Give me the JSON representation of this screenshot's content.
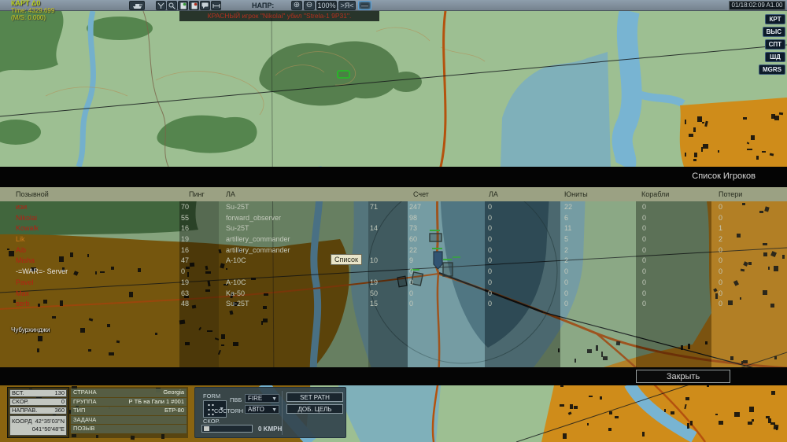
{
  "colors": {
    "accent_blue": "#5aa0d8",
    "red_player": "#b42014",
    "orange_player": "#cc7a1a",
    "urban_orange": "#cf8c1a",
    "water_teal": "#7fb0ba",
    "river_blue": "#74b0cc",
    "road_orange": "#b5520e"
  },
  "toolbar": {
    "map_label": "КАРТ Δ0",
    "time_label": "Time: 4329.699",
    "ms_label": "(M/S: 0.000)",
    "heading_label": "НАПР:",
    "zoom_in": "⊕",
    "zoom_out": "⊖",
    "zoom_value": "100%",
    "center_label": ">Я<",
    "pan_label": "—",
    "clock": "01/18:02:09 A1.00"
  },
  "kill_message": "КРАСНЫЙ игрок \"Nikolai\" убил \"Strela-1 9P31\".",
  "map_buttons": [
    "КРТ",
    "ВЫС",
    "СПТ",
    "ШД",
    "MGRS"
  ],
  "map_city_label": "Чубурхинджи",
  "player_list": {
    "title": "Список Игроков",
    "columns": [
      "Позывной",
      "Пинг",
      "ЛА",
      "Счет",
      "ЛА",
      "Юниты",
      "Корабли",
      "Потери"
    ],
    "tooltip": "Список",
    "close_label": "Закрыть",
    "rows": [
      {
        "name": "изи",
        "color": "#b42014",
        "ping": "70",
        "aircraft": "Su-25T",
        "kills": "71",
        "score": "247",
        "la": "0",
        "units": "22",
        "ships": "0",
        "losses": "0"
      },
      {
        "name": "Nikolai",
        "color": "#b42014",
        "ping": "55",
        "aircraft": "forward_observer",
        "kills": "",
        "score": "98",
        "la": "0",
        "units": "6",
        "ships": "0",
        "losses": "0"
      },
      {
        "name": "Kowalk",
        "color": "#b42014",
        "ping": "16",
        "aircraft": "Su-25T",
        "kills": "14",
        "score": "73",
        "la": "0",
        "units": "11",
        "ships": "0",
        "losses": "1"
      },
      {
        "name": "Lik",
        "color": "#cc7a1a",
        "ping": "19",
        "aircraft": "artillery_commander",
        "kills": "",
        "score": "60",
        "la": "0",
        "units": "5",
        "ships": "0",
        "losses": "2"
      },
      {
        "name": "Aib",
        "color": "#b42014",
        "ping": "16",
        "aircraft": "artillery_commander",
        "kills": "",
        "score": "22",
        "la": "0",
        "units": "2",
        "ships": "0",
        "losses": "0"
      },
      {
        "name": "Misha",
        "color": "#b42014",
        "ping": "47",
        "aircraft": "A-10C",
        "kills": "10",
        "score": "9",
        "la": "0",
        "units": "2",
        "ships": "0",
        "losses": "0"
      },
      {
        "name": "-=WAR=- Server",
        "color": "#e6e6e6",
        "ping": "0",
        "aircraft": "",
        "kills": "",
        "score": "0",
        "la": "0",
        "units": "0",
        "ships": "0",
        "losses": "0"
      },
      {
        "name": "Pavel",
        "color": "#b42014",
        "ping": "19",
        "aircraft": "A-10C",
        "kills": "19",
        "score": "0",
        "la": "0",
        "units": "0",
        "ships": "0",
        "losses": "0"
      },
      {
        "name": "Max",
        "color": "#b42014",
        "ping": "63",
        "aircraft": "Ka-50",
        "kills": "50",
        "score": "0",
        "la": "0",
        "units": "0",
        "ships": "0",
        "losses": "0"
      },
      {
        "name": "serb",
        "color": "#b42014",
        "ping": "48",
        "aircraft": "Su-25T",
        "kills": "15",
        "score": "0",
        "la": "0",
        "units": "0",
        "ships": "0",
        "losses": "0"
      }
    ]
  },
  "unit_info": {
    "rows": [
      {
        "label": "ВСТ.",
        "value": "130"
      },
      {
        "label": "СКОР.",
        "value": "0"
      },
      {
        "label": "НАПРАВ.",
        "value": "360"
      }
    ],
    "coord_label": "КООРД",
    "coord_lat": "42°35'03\"N",
    "coord_lon": "041°50'48\"E"
  },
  "group_info": {
    "rows": [
      {
        "label": "СТРАНА",
        "value": "Georgia"
      },
      {
        "label": "ГРУППА",
        "value": "Р ТБ на Гали 1 #001"
      },
      {
        "label": "ТИП",
        "value": "БТР-80"
      },
      {
        "label": "ЗАДАЧА",
        "value": ""
      },
      {
        "label": "ПОЗЫВ",
        "value": ""
      }
    ]
  },
  "command_panel": {
    "form_label": "FORM",
    "roe_label": "ПВБ",
    "roe_value": "FIRE",
    "state_label": "СОСТОЯН",
    "state_value": "АВТО",
    "set_path_label": "SET PATH",
    "add_target_label": "ДОБ. ЦЕЛЬ",
    "speed_label": "СКОР.",
    "speed_value": "0 KMPH"
  }
}
